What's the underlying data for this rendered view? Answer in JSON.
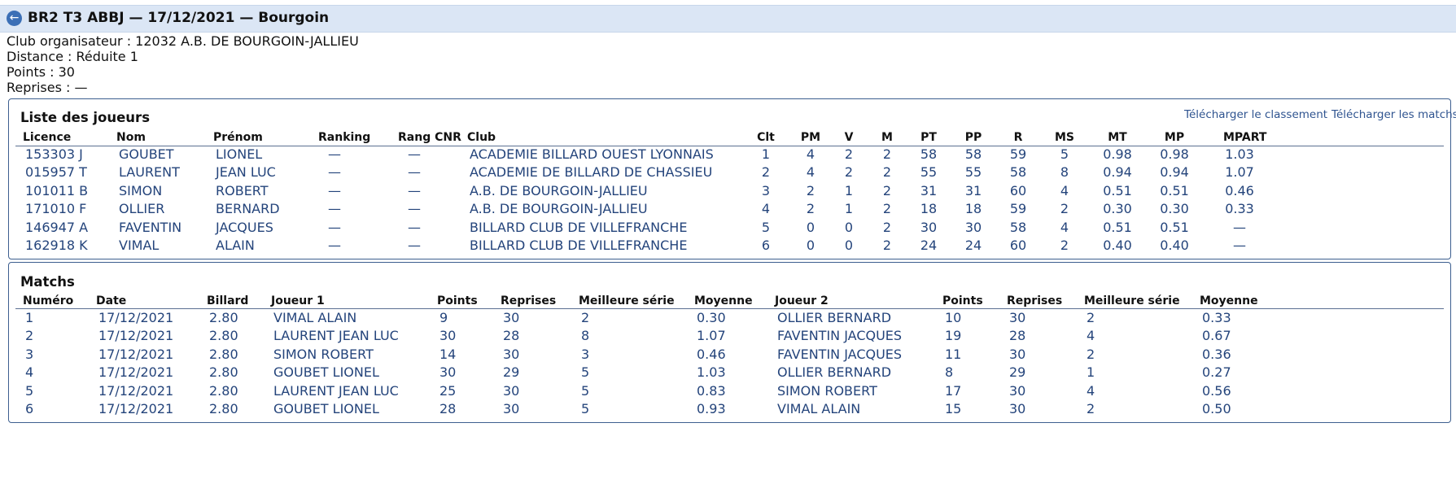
{
  "header": {
    "title": "BR2 T3 ABBJ — 17/12/2021 — Bourgoin",
    "back_icon": "arrow-left-circle"
  },
  "info": {
    "club": "Club organisateur : 12032 A.B. DE BOURGOIN-JALLIEU",
    "distance": "Distance : Réduite 1",
    "points": "Points : 30",
    "reprises": "Reprises : —"
  },
  "players": {
    "title": "Liste des joueurs",
    "download_ranking": "Télécharger le classement",
    "download_matches": "Télécharger les matchs",
    "columns": [
      "Licence",
      "Nom",
      "Prénom",
      "Ranking",
      "Rang CNR",
      "Club",
      "Clt",
      "PM",
      "V",
      "M",
      "PT",
      "PP",
      "R",
      "MS",
      "MT",
      "MP",
      "MPART"
    ],
    "rows": [
      [
        "153303 J",
        "GOUBET",
        "LIONEL",
        "—",
        "—",
        "ACADEMIE BILLARD OUEST LYONNAIS",
        "1",
        "4",
        "2",
        "2",
        "58",
        "58",
        "59",
        "5",
        "0.98",
        "0.98",
        "1.03"
      ],
      [
        "015957 T",
        "LAURENT",
        "JEAN LUC",
        "—",
        "—",
        "ACADEMIE DE BILLARD DE CHASSIEU",
        "2",
        "4",
        "2",
        "2",
        "55",
        "55",
        "58",
        "8",
        "0.94",
        "0.94",
        "1.07"
      ],
      [
        "101011 B",
        "SIMON",
        "ROBERT",
        "—",
        "—",
        "A.B. DE BOURGOIN-JALLIEU",
        "3",
        "2",
        "1",
        "2",
        "31",
        "31",
        "60",
        "4",
        "0.51",
        "0.51",
        "0.46"
      ],
      [
        "171010 F",
        "OLLIER",
        "BERNARD",
        "—",
        "—",
        "A.B. DE BOURGOIN-JALLIEU",
        "4",
        "2",
        "1",
        "2",
        "18",
        "18",
        "59",
        "2",
        "0.30",
        "0.30",
        "0.33"
      ],
      [
        "146947 A",
        "FAVENTIN",
        "JACQUES",
        "—",
        "—",
        "BILLARD CLUB DE VILLEFRANCHE",
        "5",
        "0",
        "0",
        "2",
        "30",
        "30",
        "58",
        "4",
        "0.51",
        "0.51",
        "—"
      ],
      [
        "162918 K",
        "VIMAL",
        "ALAIN",
        "—",
        "—",
        "BILLARD CLUB DE VILLEFRANCHE",
        "6",
        "0",
        "0",
        "2",
        "24",
        "24",
        "60",
        "2",
        "0.40",
        "0.40",
        "—"
      ]
    ]
  },
  "matches": {
    "title": "Matchs",
    "columns": [
      "Numéro",
      "Date",
      "Billard",
      "Joueur 1",
      "Points",
      "Reprises",
      "Meilleure série",
      "Moyenne",
      "Joueur 2",
      "Points",
      "Reprises",
      "Meilleure série",
      "Moyenne"
    ],
    "rows": [
      [
        "1",
        "17/12/2021",
        "2.80",
        "VIMAL ALAIN",
        "9",
        "30",
        "2",
        "0.30",
        "OLLIER BERNARD",
        "10",
        "30",
        "2",
        "0.33"
      ],
      [
        "2",
        "17/12/2021",
        "2.80",
        "LAURENT JEAN LUC",
        "30",
        "28",
        "8",
        "1.07",
        "FAVENTIN JACQUES",
        "19",
        "28",
        "4",
        "0.67"
      ],
      [
        "3",
        "17/12/2021",
        "2.80",
        "SIMON ROBERT",
        "14",
        "30",
        "3",
        "0.46",
        "FAVENTIN JACQUES",
        "11",
        "30",
        "2",
        "0.36"
      ],
      [
        "4",
        "17/12/2021",
        "2.80",
        "GOUBET LIONEL",
        "30",
        "29",
        "5",
        "1.03",
        "OLLIER BERNARD",
        "8",
        "29",
        "1",
        "0.27"
      ],
      [
        "5",
        "17/12/2021",
        "2.80",
        "LAURENT JEAN LUC",
        "25",
        "30",
        "5",
        "0.83",
        "SIMON ROBERT",
        "17",
        "30",
        "4",
        "0.56"
      ],
      [
        "6",
        "17/12/2021",
        "2.80",
        "GOUBET LIONEL",
        "28",
        "30",
        "5",
        "0.93",
        "VIMAL ALAIN",
        "15",
        "30",
        "2",
        "0.50"
      ]
    ]
  },
  "colors": {
    "accent": "#3b6fb6",
    "text_link": "#24447b",
    "header_bg": "#dbe6f5",
    "panel_border": "#3d5f8f"
  }
}
